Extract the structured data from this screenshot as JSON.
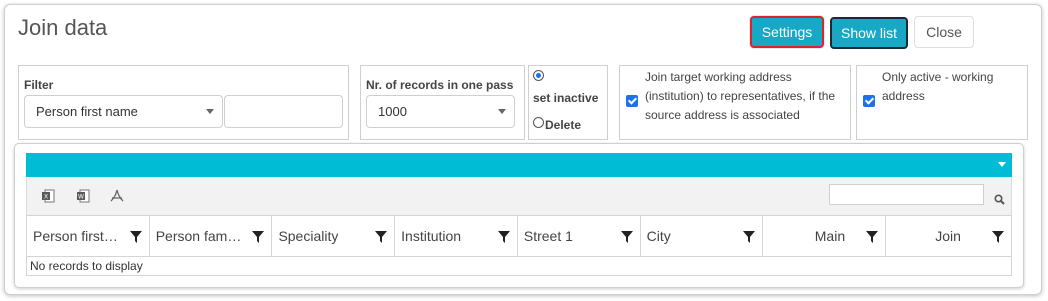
{
  "dialog": {
    "title": "Join data",
    "buttons": {
      "settings": "Settings",
      "show_list": "Show list",
      "close": "Close"
    }
  },
  "filter": {
    "label": "Filter",
    "field_value": "Person first name",
    "text_value": ""
  },
  "records": {
    "label": "Nr. of records in one pass",
    "value": "1000"
  },
  "action": {
    "set_inactive": "set inactive",
    "delete": "Delete",
    "selected": "set inactive"
  },
  "options": {
    "join_target": {
      "label": "Join target working address (institution) to representatives, if the source address is associated",
      "checked": true
    },
    "only_active": {
      "label": "Only active - working address",
      "checked": true
    }
  },
  "grid": {
    "header_color": "#00bcd4",
    "toolbar_icons": [
      "excel-icon",
      "word-icon",
      "pdf-icon"
    ],
    "search_placeholder": "",
    "columns": [
      {
        "label": "Person first ..."
      },
      {
        "label": "Person fami..."
      },
      {
        "label": "Speciality"
      },
      {
        "label": "Institution"
      },
      {
        "label": "Street 1"
      },
      {
        "label": "City"
      },
      {
        "label": "Main"
      },
      {
        "label": "Join"
      }
    ],
    "empty_text": "No records to display"
  },
  "colors": {
    "accent": "#17a8c5",
    "checkbox": "#1a73e8",
    "focus_border": "#d9232e"
  }
}
